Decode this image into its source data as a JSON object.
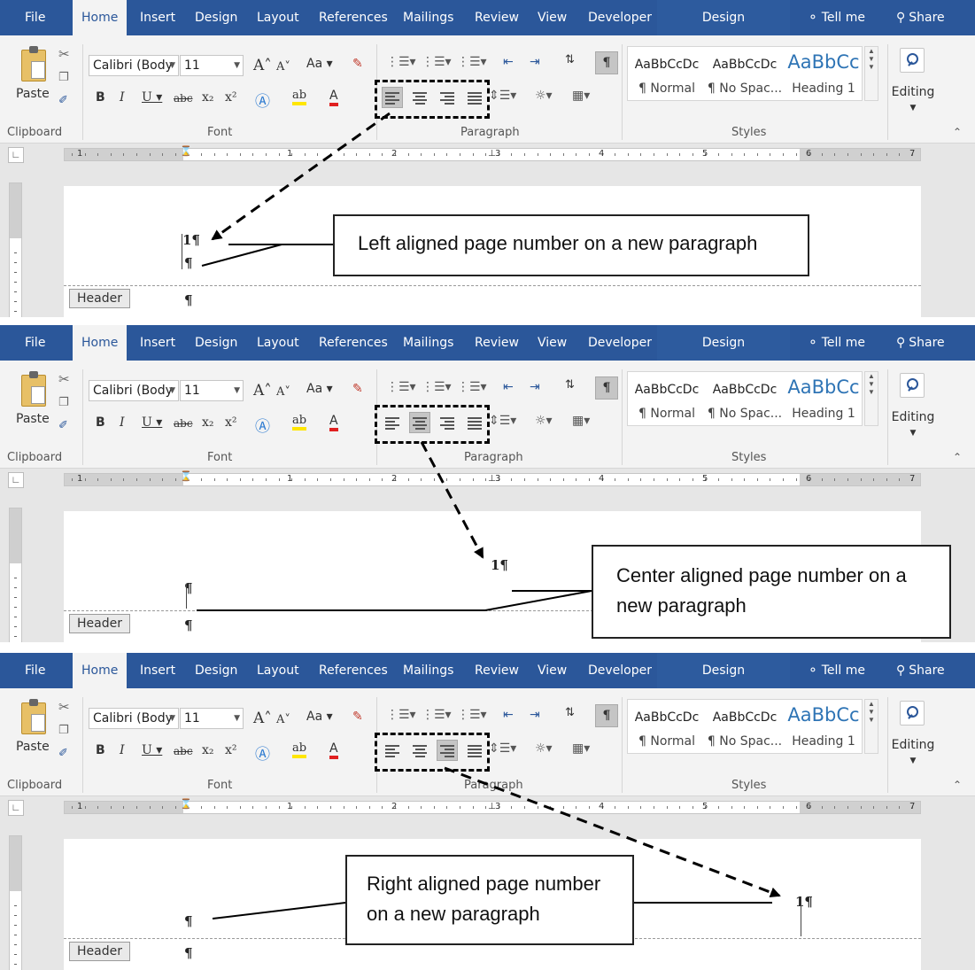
{
  "tabs": [
    "File",
    "Home",
    "Insert",
    "Design",
    "Layout",
    "References",
    "Mailings",
    "Review",
    "View",
    "Developer"
  ],
  "context_tab": "Design",
  "tell_me": "Tell me",
  "share": "Share",
  "clipboard": {
    "paste": "Paste",
    "label": "Clipboard"
  },
  "font": {
    "name": "Calibri (Body",
    "size": "11",
    "change_case": "Aa",
    "label": "Font"
  },
  "paragraph": {
    "label": "Paragraph"
  },
  "styles": {
    "label": "Styles",
    "items": [
      {
        "sample": "AaBbCcDc",
        "name": "¶ Normal"
      },
      {
        "sample": "AaBbCcDc",
        "name": "¶ No Spac..."
      },
      {
        "sample": "AaBbCc",
        "name": "Heading 1"
      }
    ]
  },
  "editing": "Editing",
  "ruler_numbers": [
    "1",
    "1",
    "2",
    "3",
    "4",
    "5",
    "6",
    "7"
  ],
  "header_tag": "Header",
  "pilcrow": "¶",
  "page_number_mark": "1¶",
  "panels": [
    {
      "alignment": "left",
      "callout": "Left aligned page number on a new paragraph"
    },
    {
      "alignment": "center",
      "callout": "Center aligned page number on a new paragraph"
    },
    {
      "alignment": "right",
      "callout": "Right aligned page number on a new paragraph"
    }
  ],
  "colors": {
    "ribbon_blue": "#2b579a",
    "ribbon_bg": "#f3f3f3",
    "heading_blue": "#2e74b5",
    "doc_bg": "#e6e6e6"
  },
  "icons": [
    "lightbulb-icon",
    "share-person-icon",
    "paste-icon",
    "cut-icon",
    "copy-icon",
    "format-painter-icon",
    "bullets-icon",
    "numbering-icon",
    "multilevel-icon",
    "decrease-indent-icon",
    "increase-indent-icon",
    "sort-icon",
    "show-marks-icon",
    "align-left-icon",
    "align-center-icon",
    "align-right-icon",
    "justify-icon",
    "line-spacing-icon",
    "shading-icon",
    "borders-icon",
    "search-icon"
  ]
}
